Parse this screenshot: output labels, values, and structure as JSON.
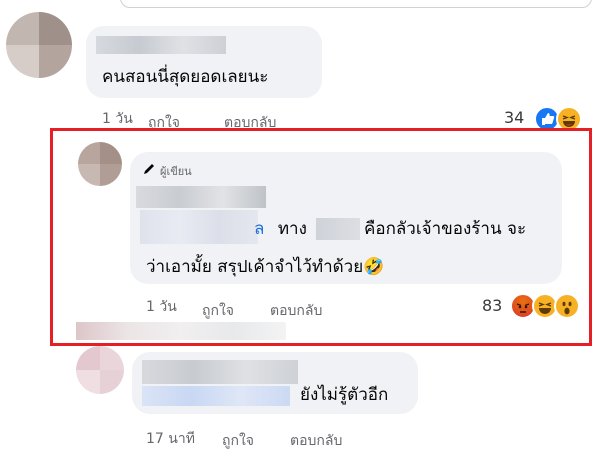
{
  "comments": [
    {
      "text": "คนสอนนี่สุดยอดเลยนะ",
      "time": "1 วัน",
      "like_label": "ถูกใจ",
      "reply_label": "ตอบกลับ",
      "reaction_count": "34",
      "reactions": [
        "like-icon",
        "haha-icon"
      ]
    },
    {
      "author_badge": "ผู้เขียน",
      "link_fragment": "ล",
      "line1_a": "ทาง",
      "line1_b": "คือกลัวเจ้าของร้าน จะ",
      "line2": "ว่าเอามั้ย  สรุปเค้าจำไว้ทำด้วย",
      "emoji": "🤣",
      "time": "1 วัน",
      "like_label": "ถูกใจ",
      "reply_label": "ตอบกลับ",
      "reaction_count": "83",
      "reactions": [
        "angry-icon",
        "haha-icon",
        "wow-icon"
      ]
    },
    {
      "text": "ยังไม่รู้ตัวอีก",
      "time": "17 นาที",
      "like_label": "ถูกใจ",
      "reply_label": "ตอบกลับ"
    }
  ],
  "colors": {
    "highlight": "#e41f26",
    "bubble": "#f0f2f5",
    "meta_text": "#65676b",
    "like_blue": "#1877f2",
    "haha_yellow": "#f7b125",
    "angry_red": "#e9710f"
  }
}
